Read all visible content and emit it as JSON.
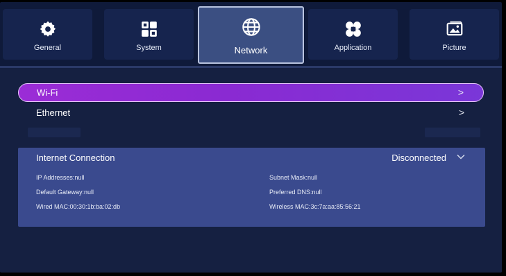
{
  "tabs": [
    {
      "id": "general",
      "label": "General",
      "icon": "gear-icon",
      "active": false
    },
    {
      "id": "system",
      "label": "System",
      "icon": "system-grid-icon",
      "active": false
    },
    {
      "id": "network",
      "label": "Network",
      "icon": "globe-icon",
      "active": true
    },
    {
      "id": "application",
      "label": "Application",
      "icon": "apps-clover-icon",
      "active": false
    },
    {
      "id": "picture",
      "label": "Picture",
      "icon": "picture-icon",
      "active": false
    }
  ],
  "menu": {
    "wifi": {
      "label": "Wi-Fi",
      "chevron": ">"
    },
    "ethernet": {
      "label": "Ethernet",
      "chevron": ">"
    }
  },
  "internet": {
    "title": "Internet Connection",
    "status": "Disconnected",
    "ip": "IP Addresses:null",
    "gateway": "Default Gateway:null",
    "wired_mac": "Wired MAC:00:30:1b:ba:02:db",
    "subnet": "Subnet Mask:null",
    "dns": "Preferred DNS:null",
    "wireless_mac": "Wireless MAC:3c:7a:aa:85:56:21"
  },
  "colors": {
    "background": "#0f1a3a",
    "content": "#152041",
    "tab": "#16244e",
    "tab_active": "#3b4f82",
    "selection_gradient_start": "#9b2cd6",
    "selection_gradient_end": "#7a37d8",
    "info_panel": "#3a4a8e"
  }
}
